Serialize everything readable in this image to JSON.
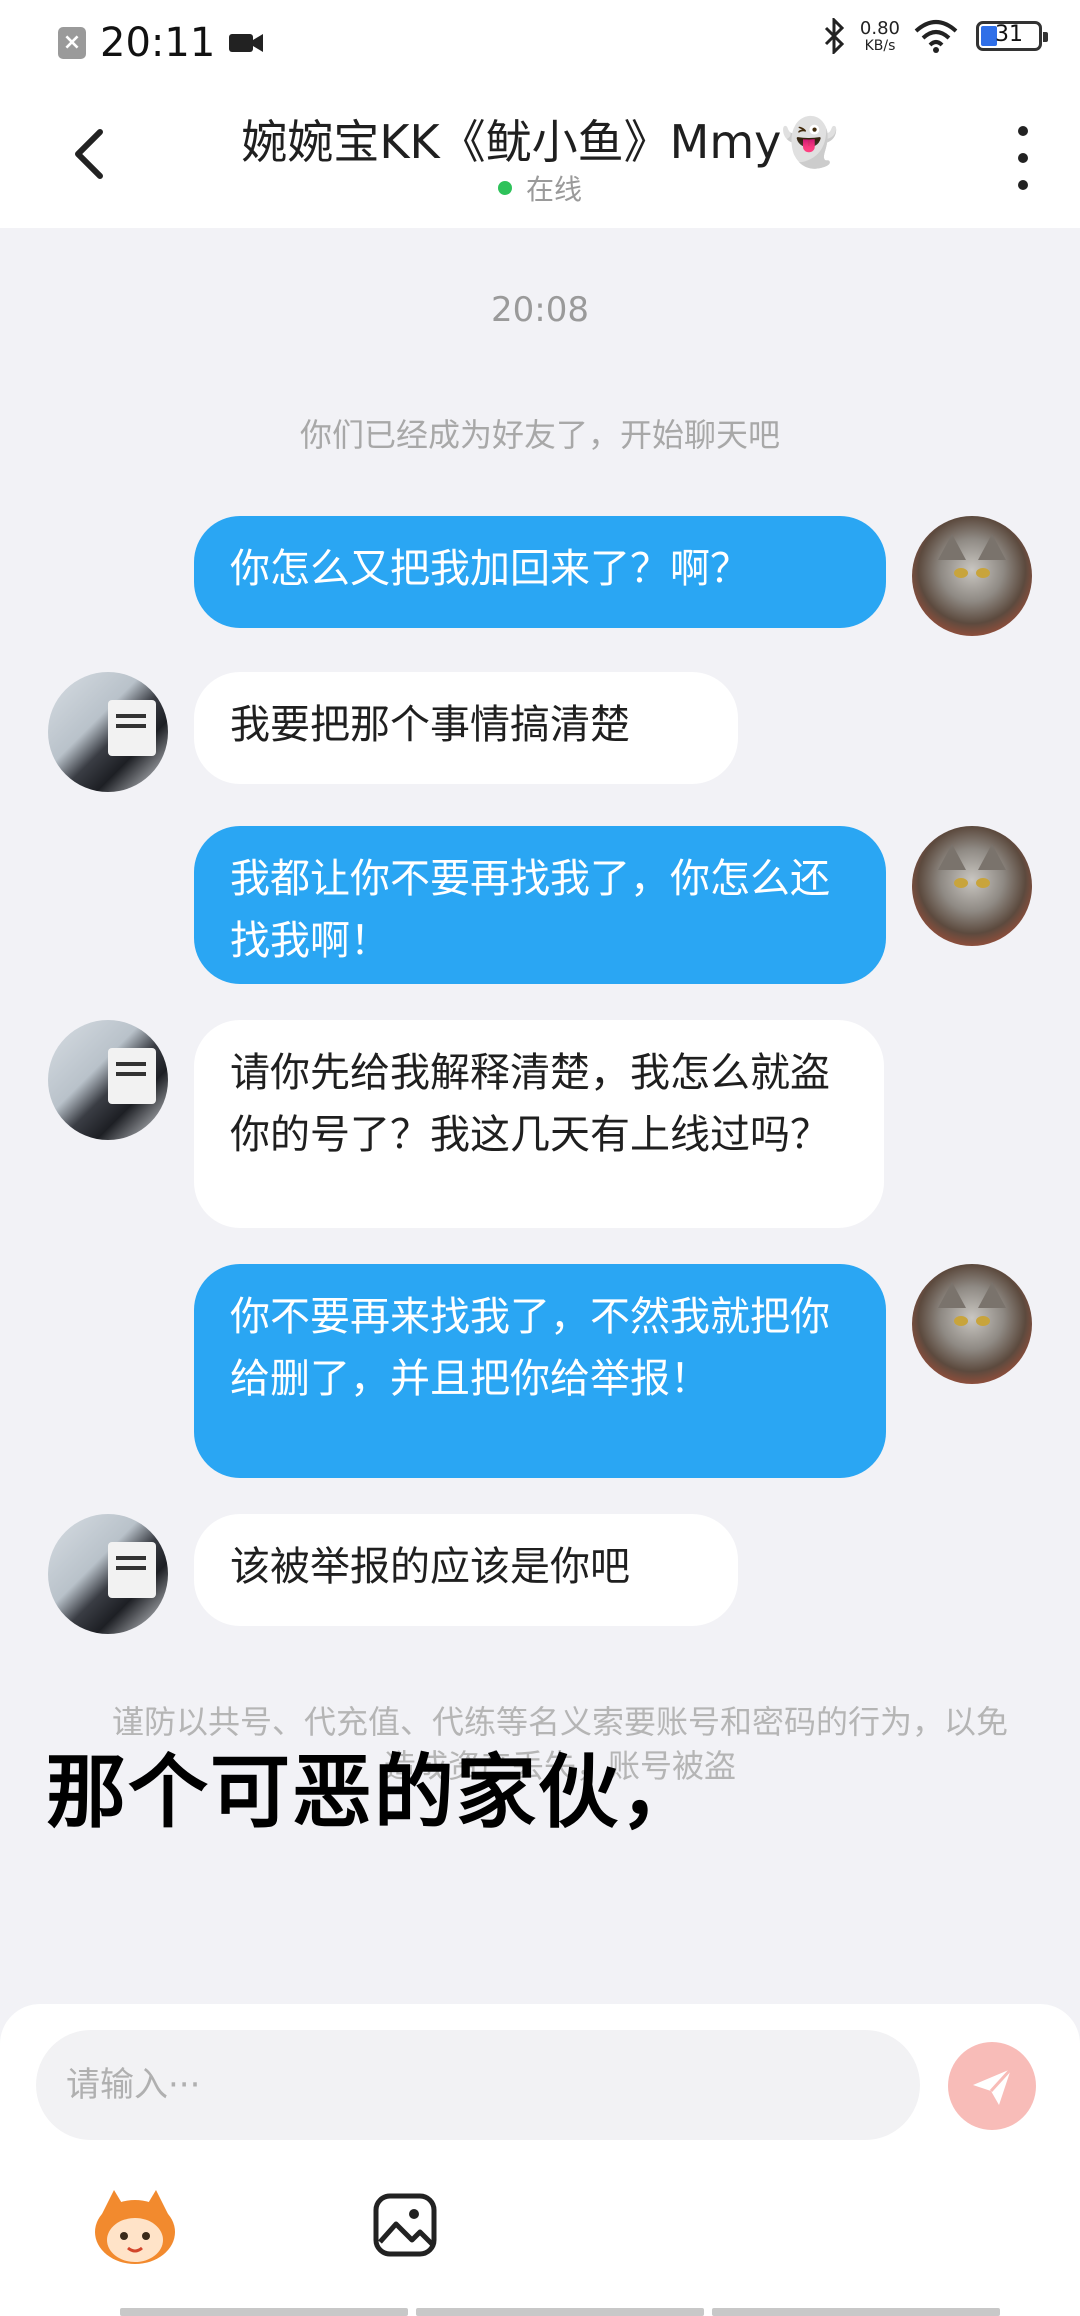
{
  "status_bar": {
    "time": "20:11",
    "net_speed_value": "0.80",
    "net_speed_unit": "KB/s",
    "battery_level": "31",
    "notif_icon": "close-box-icon",
    "video_icon": "video-camera-icon"
  },
  "header": {
    "title": "婉婉宝KK《鱿小鱼》Mmy👻",
    "status": "在线"
  },
  "chat": {
    "timestamp": "20:08",
    "system_message": "你们已经成为好友了，开始聊天吧",
    "messages": [
      {
        "sender": "me",
        "text": "你怎么又把我加回来了？啊？"
      },
      {
        "sender": "them",
        "text": "我要把那个事情搞清楚"
      },
      {
        "sender": "me",
        "text": "我都让你不要再找我了，你怎么还找我啊！"
      },
      {
        "sender": "them",
        "text": "请你先给我解释清楚，我怎么就盗你的号了？我这几天有上线过吗？"
      },
      {
        "sender": "me",
        "text": "你不要再来找我了，不然我就把你给删了，并且把你给举报！"
      },
      {
        "sender": "them",
        "text": "该被举报的应该是你吧"
      }
    ],
    "safety_notice": "谨防以共号、代充值、代练等名义索要账号和密码的行为，以免造成资产丢失，账号被盗"
  },
  "subtitle": "那个可恶的家伙，",
  "input": {
    "placeholder": "请输入···"
  },
  "colors": {
    "my_bubble": "#2aa6f3",
    "their_bubble": "#ffffff",
    "background": "#f2f2f6",
    "online_dot": "#2ec25a",
    "send_button": "#f8bcb8"
  }
}
